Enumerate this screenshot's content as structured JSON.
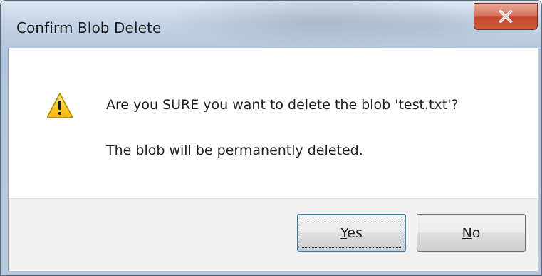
{
  "window": {
    "title": "Confirm Blob Delete",
    "close_glyph": "X"
  },
  "message": {
    "icon": "warning-icon",
    "line1": "Are you SURE you want to delete the blob 'test.txt'?",
    "line2": "The blob will be permanently deleted."
  },
  "buttons": {
    "yes": {
      "mnemonic": "Y",
      "rest": "es"
    },
    "no": {
      "mnemonic": "N",
      "rest": "o"
    }
  },
  "colors": {
    "close_button": "#c4472c",
    "warning_fill": "#f5c518",
    "focus_border": "#3c7fb1"
  }
}
